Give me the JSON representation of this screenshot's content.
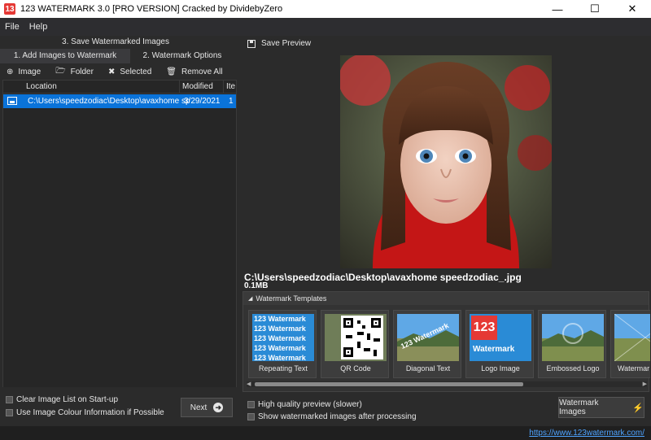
{
  "window": {
    "title": "123 WATERMARK 3.0 [PRO VERSION] Cracked by DividebyZero",
    "app_icon": "13",
    "minimize_glyph": "—",
    "maximize_glyph": "☐",
    "close_glyph": "✕"
  },
  "menu": [
    "File",
    "Help"
  ],
  "tabs": {
    "save": "3. Save Watermarked Images",
    "add": "1. Add Images to Watermark",
    "options": "2. Watermark Options"
  },
  "toolbar": {
    "image": "Image",
    "folder": "Folder",
    "selected": "Selected",
    "remove_all": "Remove All"
  },
  "file_list": {
    "columns": [
      "Location",
      "Modified",
      "Ite"
    ],
    "rows": [
      {
        "location": "C:\\Users\\speedzodiac\\Desktop\\avaxhome sp",
        "modified": "3/29/2021",
        "items": "1"
      }
    ]
  },
  "left_footer": {
    "clear_list": "Clear Image List on Start-up",
    "use_colour": "Use Image Colour Information if Possible",
    "next": "Next"
  },
  "preview": {
    "save_label": "Save Preview",
    "file_path": "C:\\Users\\speedzodiac\\Desktop\\avaxhome speedzodiac_.jpg",
    "file_size": "0.1MB"
  },
  "templates": {
    "header": "Watermark Templates",
    "items": [
      {
        "label": "Repeating Text",
        "thumb_text": "123 Watermark"
      },
      {
        "label": "QR Code"
      },
      {
        "label": "Diagonal Text",
        "thumb_text": "123 Watermark"
      },
      {
        "label": "Logo Image",
        "thumb_text": "123",
        "thumb_text2": "Watermark"
      },
      {
        "label": "Embossed Logo"
      },
      {
        "label": "Watermar"
      }
    ]
  },
  "right_footer": {
    "high_quality": "High quality preview (slower)",
    "show_after": "Show watermarked images after processing",
    "watermark_button": "Watermark Images"
  },
  "status": {
    "link": "https://www.123watermark.com/"
  },
  "colors": {
    "selection": "#0a73d9",
    "link": "#4ea3ff",
    "accent_logo": "#e53935"
  }
}
